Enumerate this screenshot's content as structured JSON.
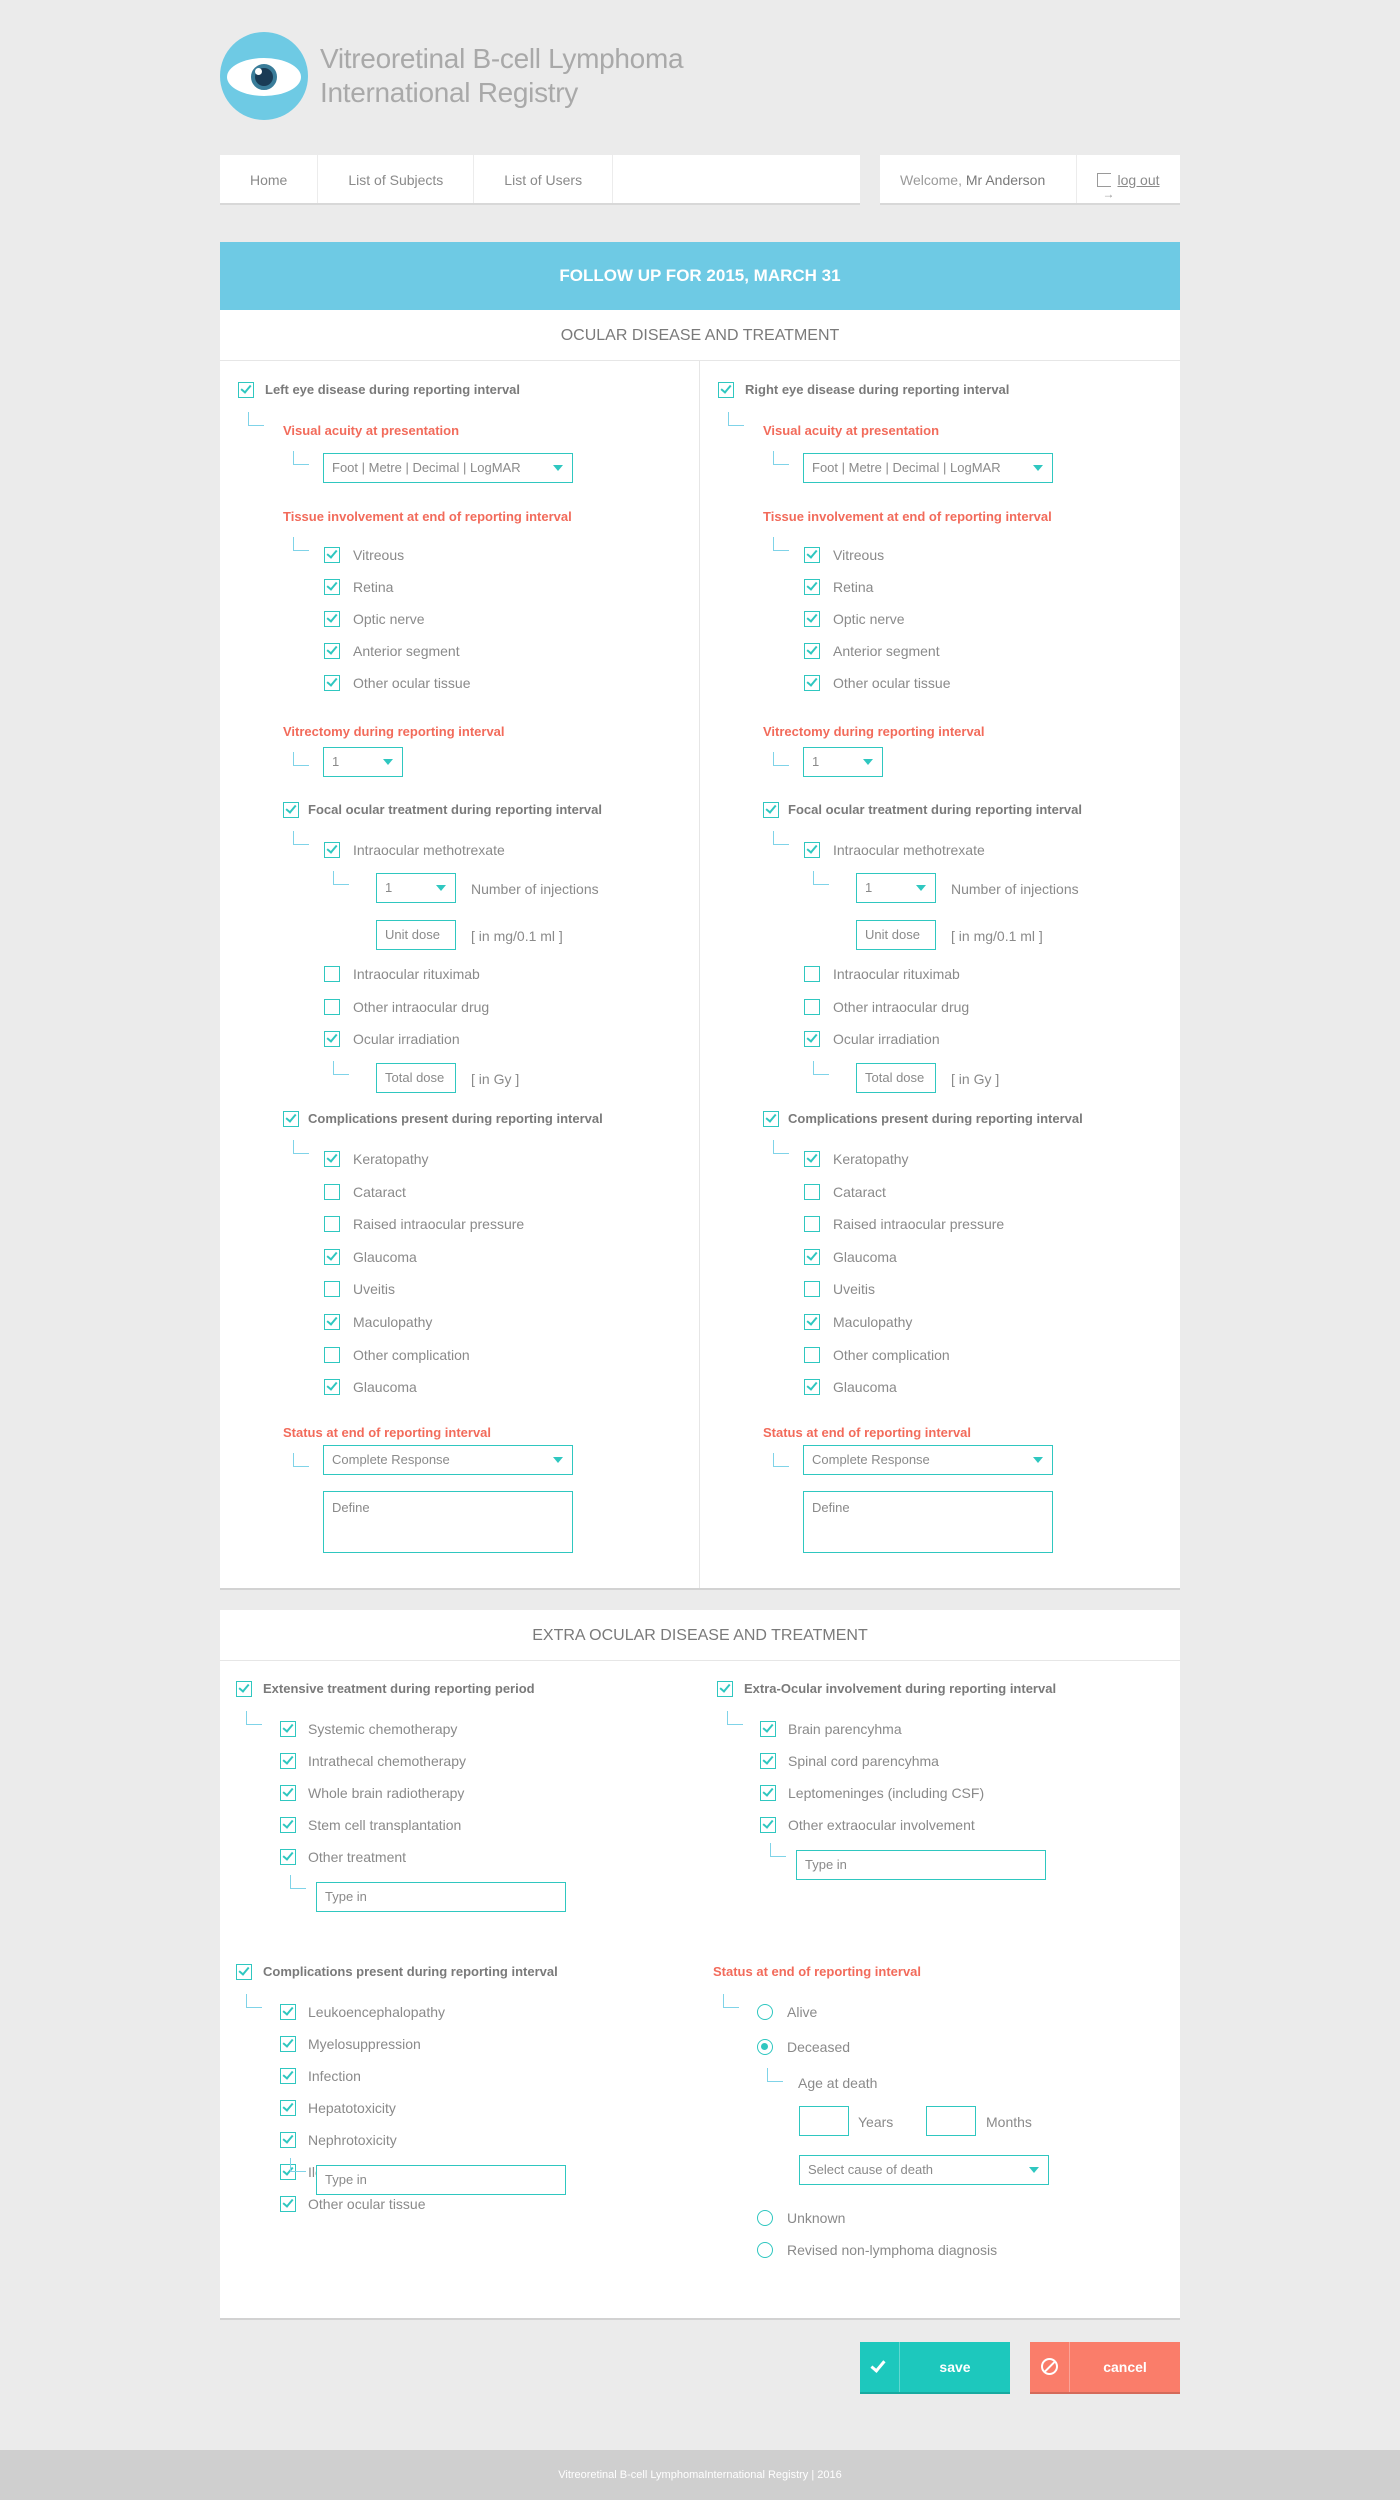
{
  "app": {
    "title_line1": "Vitreoretinal B-cell Lymphoma",
    "title_line2": "International Registry"
  },
  "nav": {
    "items": [
      "Home",
      "List of Subjects",
      "List of Users"
    ]
  },
  "user": {
    "welcome": "Welcome,",
    "name": "Mr Anderson",
    "logout": "log out"
  },
  "banner": "FOLLOW UP FOR 2015, MARCH 31",
  "ocular": {
    "title": "OCULAR DISEASE AND TREATMENT",
    "left_title": "Left eye disease during reporting interval",
    "right_title": "Right eye disease during reporting interval",
    "visual_acuity_label": "Visual acuity at presentation",
    "visual_acuity_value": "Foot  |  Metre  |  Decimal  |  LogMAR",
    "tissue_label": "Tissue involvement at end of reporting interval",
    "tissues": [
      {
        "label": "Vitreous",
        "checked": true
      },
      {
        "label": "Retina",
        "checked": true
      },
      {
        "label": "Optic nerve",
        "checked": true
      },
      {
        "label": "Anterior segment",
        "checked": true
      },
      {
        "label": "Other ocular tissue",
        "checked": true
      }
    ],
    "vitrectomy_label": "Vitrectomy during reporting interval",
    "vitrectomy_value": "1",
    "focal_label": "Focal ocular treatment during reporting interval",
    "methotrexate_label": "Intraocular methotrexate",
    "injections_value": "1",
    "injections_label": "Number of injections",
    "unit_dose_placeholder": "Unit dose",
    "unit_dose_unit": "[ in mg/0.1 ml ]",
    "rituximab_label": "Intraocular rituximab",
    "other_drug_label": "Other intraocular drug",
    "irradiation_label": "Ocular irradiation",
    "total_dose_placeholder": "Total dose",
    "total_dose_unit": "[ in Gy ]",
    "complications_label": "Complications present during reporting interval",
    "complications": [
      {
        "label": "Keratopathy",
        "checked": true
      },
      {
        "label": "Cataract",
        "checked": false
      },
      {
        "label": "Raised intraocular pressure",
        "checked": false
      },
      {
        "label": "Glaucoma",
        "checked": true
      },
      {
        "label": "Uveitis",
        "checked": false
      },
      {
        "label": "Maculopathy",
        "checked": true
      },
      {
        "label": "Other complication",
        "checked": false
      },
      {
        "label": "Glaucoma",
        "checked": true
      }
    ],
    "status_label": "Status at end of reporting interval",
    "status_value": "Complete Response",
    "define_placeholder": "Define"
  },
  "extra": {
    "title": "EXTRA OCULAR DISEASE AND TREATMENT",
    "treatment_title": "Extensive treatment during reporting period",
    "treatments": [
      {
        "label": "Systemic chemotherapy",
        "checked": true
      },
      {
        "label": "Intrathecal chemotherapy",
        "checked": true
      },
      {
        "label": "Whole brain radiotherapy",
        "checked": true
      },
      {
        "label": "Stem cell transplantation",
        "checked": true
      },
      {
        "label": "Other treatment",
        "checked": true
      }
    ],
    "type_in": "Type in",
    "involvement_title": "Extra-Ocular involvement during reporting interval",
    "involvements": [
      {
        "label": "Brain parencyhma",
        "checked": true
      },
      {
        "label": "Spinal cord parencyhma",
        "checked": true
      },
      {
        "label": "Leptomeninges (including CSF)",
        "checked": true
      },
      {
        "label": "Other extraocular involvement",
        "checked": true
      }
    ],
    "complications_title": "Complications present during reporting interval",
    "complications": [
      {
        "label": "Leukoencephalopathy",
        "checked": true
      },
      {
        "label": "Myelosuppression",
        "checked": true
      },
      {
        "label": "Infection",
        "checked": true
      },
      {
        "label": "Hepatotoxicity",
        "checked": true
      },
      {
        "label": "Nephrotoxicity",
        "checked": true
      },
      {
        "label": "Ileus",
        "checked": true
      },
      {
        "label": "Other ocular tissue",
        "checked": true
      }
    ],
    "status_title": "Status at end of reporting interval",
    "status_alive": "Alive",
    "status_deceased": "Deceased",
    "age_at_death": "Age at death",
    "years": "Years",
    "months": "Months",
    "cause_placeholder": "Select cause of death",
    "status_unknown": "Unknown",
    "status_revised": "Revised non-lymphoma diagnosis",
    "selected_status": "Deceased"
  },
  "buttons": {
    "save": "save",
    "cancel": "cancel"
  },
  "footer": "Vitreoretinal B-cell LymphomaInternational Registry | 2016",
  "colors": {
    "accent": "#2fc7c0",
    "banner": "#6ecae4",
    "red": "#f26b5b",
    "save": "#1dc8bd",
    "cancel": "#fa7d6a"
  }
}
